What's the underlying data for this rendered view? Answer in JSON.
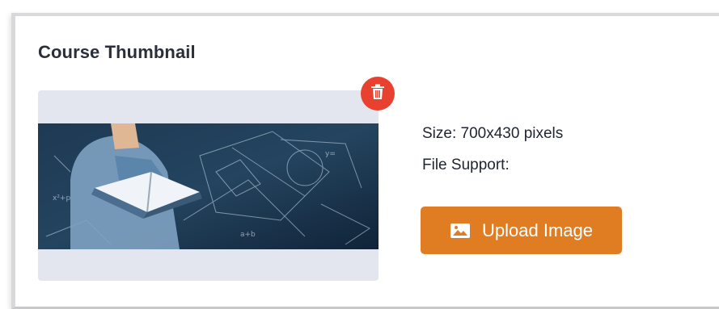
{
  "section": {
    "title": "Course Thumbnail"
  },
  "thumbnail": {
    "image_icon": "person-reading-book-with-math-formulas",
    "delete_icon": "trash-icon"
  },
  "info": {
    "size_text": "Size: 700x430 pixels",
    "support_text": "File Support:"
  },
  "upload": {
    "label": "Upload Image",
    "icon": "image-icon"
  },
  "colors": {
    "accent": "#e07d22",
    "danger": "#e8412f",
    "panel": "#e3e6ee"
  }
}
